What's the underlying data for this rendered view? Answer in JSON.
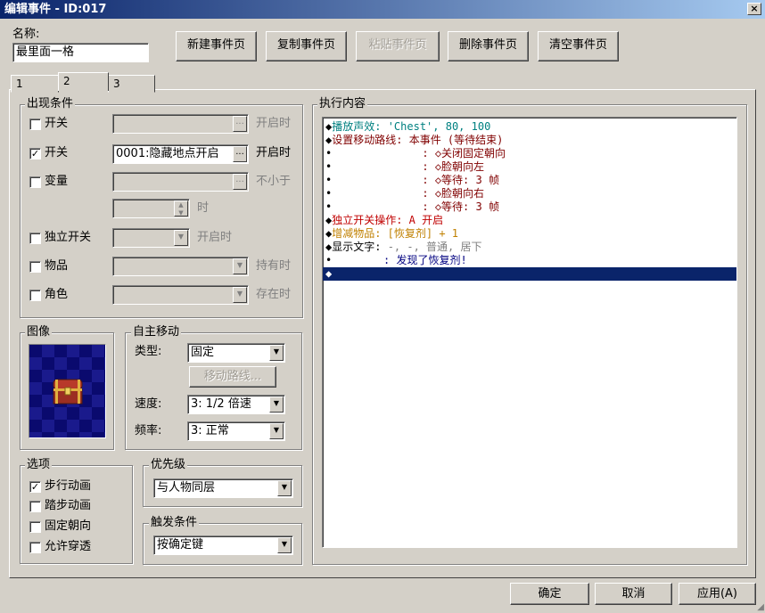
{
  "window": {
    "title": "编辑事件 - ID:017",
    "close": "×"
  },
  "name_label": "名称:",
  "name_value": "最里面一格",
  "page_buttons": [
    "新建事件页",
    "复制事件页",
    "粘贴事件页",
    "删除事件页",
    "清空事件页"
  ],
  "tabs": [
    "1",
    "2",
    "3"
  ],
  "conditions": {
    "title": "出现条件",
    "switch1": {
      "label": "开关",
      "value": "",
      "suffix": "开启时",
      "checked": false
    },
    "switch2": {
      "label": "开关",
      "value": "0001:隐藏地点开启",
      "suffix": "开启时",
      "checked": true
    },
    "variable": {
      "label": "变量",
      "value": "",
      "suffix": "不小于",
      "checked": false
    },
    "variable_unit": "时",
    "self_switch": {
      "label": "独立开关",
      "suffix": "开启时",
      "checked": false
    },
    "item": {
      "label": "物品",
      "suffix": "持有时",
      "checked": false
    },
    "actor": {
      "label": "角色",
      "suffix": "存在时",
      "checked": false
    },
    "ellipsis": "..."
  },
  "image": {
    "title": "图像"
  },
  "autonomous": {
    "title": "自主移动",
    "type_label": "类型:",
    "type_value": "固定",
    "route_button": "移动路线...",
    "speed_label": "速度:",
    "speed_value": "3: 1/2 倍速",
    "freq_label": "频率:",
    "freq_value": "3: 正常"
  },
  "options": {
    "title": "选项",
    "items": [
      {
        "label": "步行动画",
        "checked": true
      },
      {
        "label": "踏步动画",
        "checked": false
      },
      {
        "label": "固定朝向",
        "checked": false
      },
      {
        "label": "允许穿透",
        "checked": false
      }
    ]
  },
  "priority": {
    "title": "优先级",
    "value": "与人物同层"
  },
  "trigger": {
    "title": "触发条件",
    "value": "按确定键"
  },
  "contents": {
    "title": "执行内容",
    "lines": [
      {
        "prefix": "◆",
        "parts": [
          {
            "t": "播放声效:",
            "c": "#008080"
          },
          {
            "t": " 'Chest', 80, 100",
            "c": "#008080"
          }
        ]
      },
      {
        "prefix": "◆",
        "parts": [
          {
            "t": "设置移动路线:",
            "c": "#800000"
          },
          {
            "t": " 本事件 (等待结束)",
            "c": "#800000"
          }
        ]
      },
      {
        "prefix": "•",
        "parts": [
          {
            "t": "              : ◇关闭固定朝向",
            "c": "#800000"
          }
        ]
      },
      {
        "prefix": "•",
        "parts": [
          {
            "t": "              : ◇脸朝向左",
            "c": "#800000"
          }
        ]
      },
      {
        "prefix": "•",
        "parts": [
          {
            "t": "              : ◇等待: 3 帧",
            "c": "#800000"
          }
        ]
      },
      {
        "prefix": "•",
        "parts": [
          {
            "t": "              : ◇脸朝向右",
            "c": "#800000"
          }
        ]
      },
      {
        "prefix": "•",
        "parts": [
          {
            "t": "              : ◇等待: 3 帧",
            "c": "#800000"
          }
        ]
      },
      {
        "prefix": "◆",
        "parts": [
          {
            "t": "独立开关操作: A 开启",
            "c": "#c00000"
          }
        ]
      },
      {
        "prefix": "◆",
        "parts": [
          {
            "t": "增减物品: [恢复剂] + 1",
            "c": "#c08000"
          }
        ]
      },
      {
        "prefix": "◆",
        "parts": [
          {
            "t": "显示文字:",
            "c": "#000000"
          },
          {
            "t": " -, -, 普通, 居下",
            "c": "#808080"
          }
        ]
      },
      {
        "prefix": "•",
        "parts": [
          {
            "t": "        : 发现了恢复剂!",
            "c": "#000080"
          }
        ]
      },
      {
        "prefix": "◆",
        "parts": [],
        "selected": true
      }
    ]
  },
  "footer": {
    "ok": "确定",
    "cancel": "取消",
    "apply": "应用(A)"
  }
}
